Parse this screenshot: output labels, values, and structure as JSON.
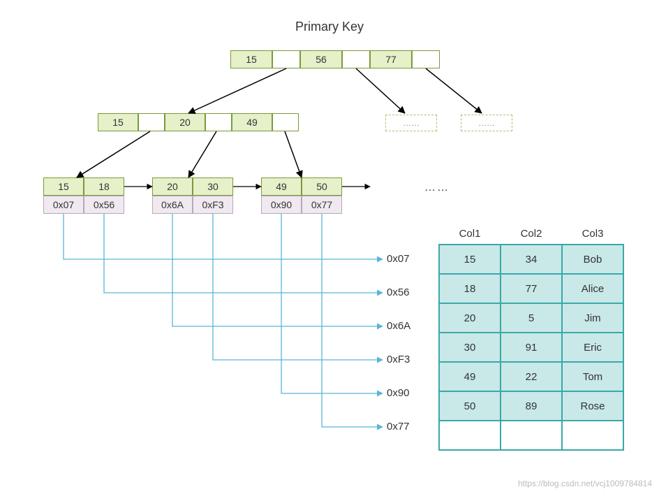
{
  "title": "Primary Key",
  "root": {
    "keys": [
      "15",
      "56",
      "77"
    ]
  },
  "internal": {
    "keys": [
      "15",
      "20",
      "49"
    ]
  },
  "dashed_ellipsis": "……",
  "leaves": [
    {
      "keys": [
        "15",
        "18"
      ],
      "ptrs": [
        "0x07",
        "0x56"
      ]
    },
    {
      "keys": [
        "20",
        "30"
      ],
      "ptrs": [
        "0x6A",
        "0xF3"
      ]
    },
    {
      "keys": [
        "49",
        "50"
      ],
      "ptrs": [
        "0x90",
        "0x77"
      ]
    }
  ],
  "leaf_ellipsis": "……",
  "rows": [
    {
      "addr": "0x07",
      "c1": "15",
      "c2": "34",
      "c3": "Bob"
    },
    {
      "addr": "0x56",
      "c1": "18",
      "c2": "77",
      "c3": "Alice"
    },
    {
      "addr": "0x6A",
      "c1": "20",
      "c2": "5",
      "c3": "Jim"
    },
    {
      "addr": "0xF3",
      "c1": "30",
      "c2": "91",
      "c3": "Eric"
    },
    {
      "addr": "0x90",
      "c1": "49",
      "c2": "22",
      "c3": "Tom"
    },
    {
      "addr": "0x77",
      "c1": "50",
      "c2": "89",
      "c3": "Rose"
    }
  ],
  "columns": [
    "Col1",
    "Col2",
    "Col3"
  ],
  "watermark": "https://blog.csdn.net/vcj1009784814"
}
